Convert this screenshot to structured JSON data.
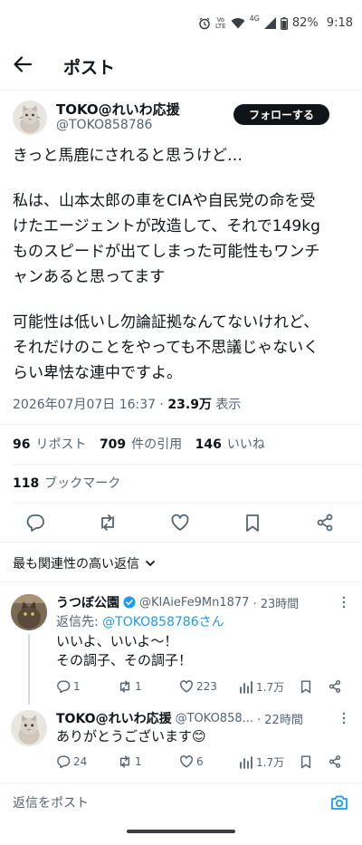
{
  "status_bar": {
    "network_top": "Vo",
    "network_bottom": "LTE",
    "net_type": "4G",
    "battery": "82%",
    "time": "9:18"
  },
  "header": {
    "title": "ポスト"
  },
  "author": {
    "name": "TOKO@れいわ応援",
    "handle": "@TOKO858786",
    "follow_label": "フォローする"
  },
  "tweet": {
    "para1": "きっと馬鹿にされると思うけど…",
    "para2": "私は、山本太郎の車をCIAや自民党の命を受\nけたエージェントが改造して、それで149kg\nものスピードが出てしまった可能性もワンチ\nャンあると思ってます",
    "para3": "可能性は低いし勿論証拠なんてないけれど、\nそれだけのことをやっても不思議じゃないく\nらい卑怯な連中ですよ。",
    "date": "2026年07月07日 16:37",
    "separator": "·",
    "views": "23.9万",
    "views_label": "表示"
  },
  "stats": {
    "reposts": "96",
    "reposts_label": "リポスト",
    "quotes": "709",
    "quotes_label": "件の引用",
    "likes": "146",
    "likes_label": "いいね",
    "bookmarks": "118",
    "bookmarks_label": "ブックマーク"
  },
  "sort": {
    "label": "最も関連性の高い返信"
  },
  "replies": [
    {
      "name": "うつぼ公園",
      "handle": "@KIAieFe9Mn1877",
      "time": "· 23時間",
      "reply_to_prefix": "返信先: ",
      "reply_to": "@TOKO858786さん",
      "text": "いいよ、いいよ〜！\nその調子、その調子！",
      "comments": "1",
      "reposts": "1",
      "likes": "223",
      "views": "1.7万"
    },
    {
      "name": "TOKO@れいわ応援",
      "handle": "@TOKO858...",
      "time": "· 22時間",
      "text": "ありがとうございます😊",
      "comments": "24",
      "reposts": "1",
      "likes": "6",
      "views": "1.7万"
    }
  ],
  "compose": {
    "placeholder": "返信をポスト"
  },
  "colors": {
    "accent": "#1d9bf0",
    "text": "#0f1419",
    "muted": "#536471"
  }
}
